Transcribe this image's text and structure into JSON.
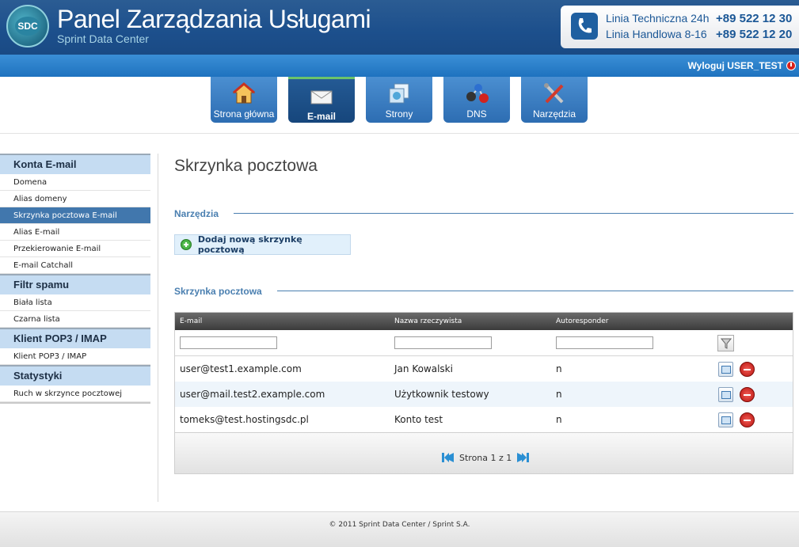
{
  "header": {
    "logo_text": "SDC",
    "title": "Panel Zarządzania Usługami",
    "subtitle": "Sprint Data Center",
    "support": [
      {
        "label": "Linia Techniczna 24h",
        "number": "+89 522 12 30"
      },
      {
        "label": "Linia Handlowa 8-16",
        "number": "+89 522 12 20"
      }
    ],
    "logout_label": "Wyloguj USER_TEST"
  },
  "nav": {
    "tabs": [
      {
        "label": "Strona główna",
        "icon": "house-icon"
      },
      {
        "label": "E-mail",
        "icon": "envelope-icon"
      },
      {
        "label": "Strony",
        "icon": "pages-icon"
      },
      {
        "label": "DNS",
        "icon": "network-icon"
      },
      {
        "label": "Narzędzia",
        "icon": "tools-icon"
      }
    ],
    "active": "E-mail"
  },
  "sidebar": {
    "groups": [
      {
        "title": "Konta E-mail",
        "items": [
          "Domena",
          "Alias domeny",
          "Skrzynka pocztowa E-mail",
          "Alias E-mail",
          "Przekierowanie E-mail",
          "E-mail Catchall"
        ]
      },
      {
        "title": "Filtr spamu",
        "items": [
          "Biała lista",
          "Czarna lista"
        ]
      },
      {
        "title": "Klient POP3 / IMAP",
        "items": [
          "Klient POP3 / IMAP"
        ]
      },
      {
        "title": "Statystyki",
        "items": [
          "Ruch w skrzynce pocztowej"
        ]
      }
    ],
    "active_item": "Skrzynka pocztowa E-mail"
  },
  "main": {
    "page_title": "Skrzynka pocztowa",
    "tools_section": "Narzędzia",
    "add_button": "Dodaj nową skrzynkę pocztową",
    "list_section": "Skrzynka pocztowa",
    "table": {
      "columns": [
        "E-mail",
        "Nazwa rzeczywista",
        "Autoresponder"
      ],
      "rows": [
        [
          "user@test1.example.com",
          "Jan Kowalski",
          "n"
        ],
        [
          "user@mail.test2.example.com",
          "Użytkownik testowy",
          "n"
        ],
        [
          "tomeks@test.hostingsdc.pl",
          "Konto test",
          "n"
        ]
      ],
      "pager_text": "Strona 1 z 1"
    }
  },
  "footer": {
    "text": "© 2011 Sprint Data Center / Sprint S.A."
  },
  "colors": {
    "header_blue": "#1c4f8c",
    "bar_blue": "#1e72bf",
    "active_row": "#4177ad",
    "section_blue": "#4a7fb0"
  }
}
